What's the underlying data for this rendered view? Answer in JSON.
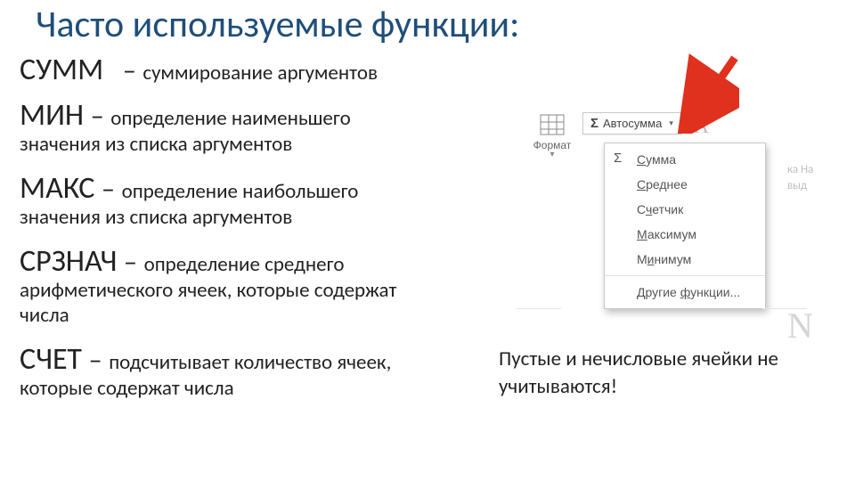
{
  "title": "Часто используемые функции:",
  "functions": [
    {
      "name": "СУММ",
      "dash": "–",
      "desc": "суммирование аргументов",
      "sub": ""
    },
    {
      "name": "МИН",
      "dash": "–",
      "desc": "определение наименьшего",
      "sub": "значения из списка аргументов"
    },
    {
      "name": "МАКС",
      "dash": "–",
      "desc": "определение наибольшего",
      "sub": "значения из списка аргументов"
    },
    {
      "name": "СРЗНАЧ",
      "dash": "–",
      "desc": "определение среднего",
      "sub": "арифметического ячеек, которые содержат числа"
    },
    {
      "name": "СЧЕТ",
      "dash": "–",
      "desc": "подсчитывает количество ячеек,",
      "sub": "которые содержат числа"
    }
  ],
  "note": "Пустые и нечисловые ячейки не учитываются!",
  "ui": {
    "format_label": "Формат",
    "autosum_label": "Автосумма",
    "menu": {
      "sum": "Сумма",
      "avg": "Среднее",
      "count": "Счетчик",
      "max": "Максимум",
      "min": "Минимум",
      "more": "Другие функции..."
    },
    "right_hint_top": "ка   На",
    "right_hint_mid": "выд",
    "ghost_big": "N"
  }
}
